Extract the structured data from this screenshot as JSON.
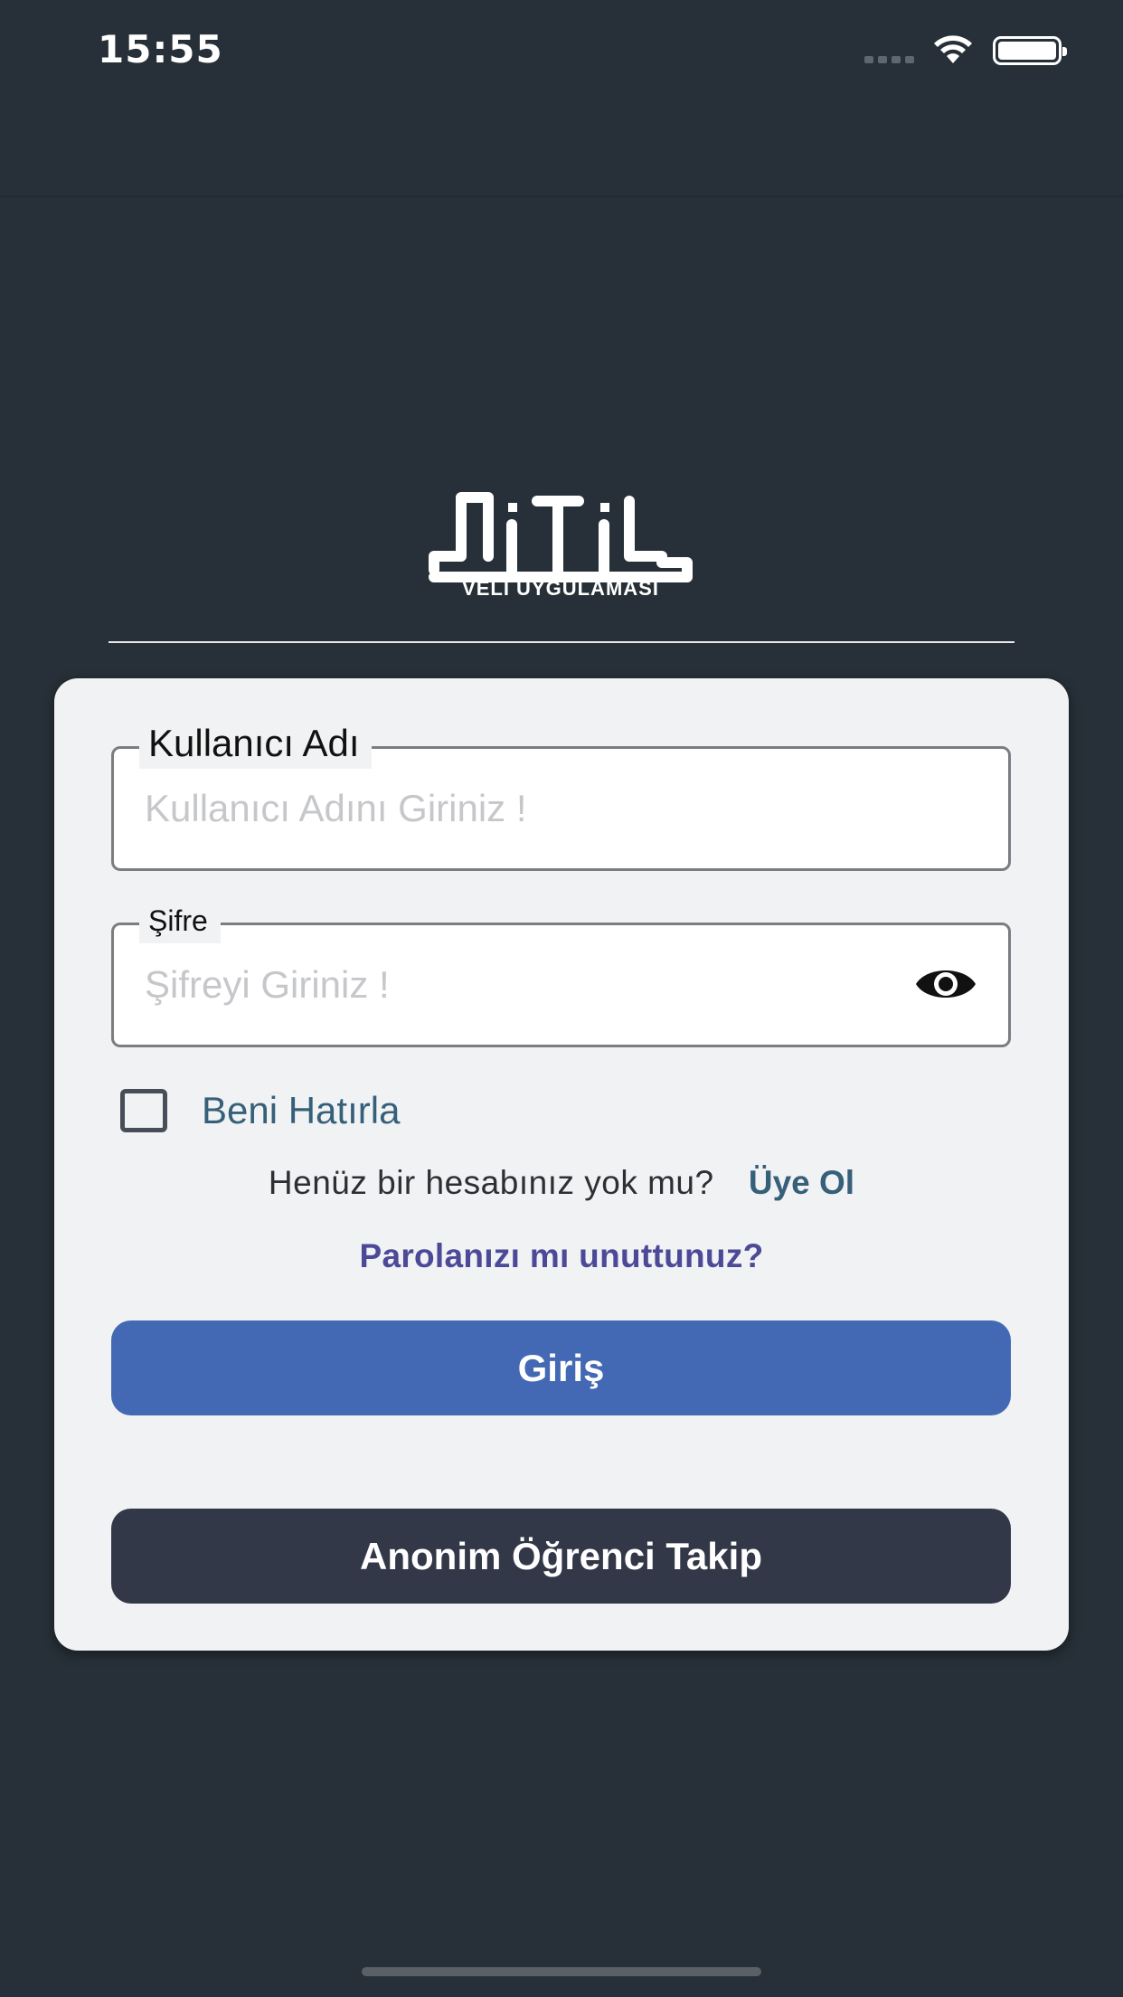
{
  "status_bar": {
    "time": "15:55"
  },
  "logo": {
    "subtitle": "VELİ UYGULAMASI"
  },
  "form": {
    "username": {
      "label": "Kullanıcı Adı",
      "placeholder": "Kullanıcı Adını Giriniz !",
      "value": ""
    },
    "password": {
      "label": "Şifre",
      "placeholder": "Şifreyi Giriniz !",
      "value": ""
    },
    "remember_label": "Beni Hatırla",
    "remember_checked": false,
    "signup_question": "Henüz bir hesabınız yok mu?",
    "signup_link": "Üye Ol",
    "forgot_link": "Parolanızı mı unuttunuz?",
    "login_button": "Giriş",
    "anon_button": "Anonim Öğrenci Takip"
  },
  "colors": {
    "background": "#273038",
    "card": "#f1f2f4",
    "primary_button": "#4469b4",
    "secondary_button": "#333848",
    "link": "#36607a",
    "forgot_link": "#4c4a98"
  },
  "icons": [
    "wifi-icon",
    "battery-icon",
    "eye-icon",
    "checkbox-icon"
  ]
}
